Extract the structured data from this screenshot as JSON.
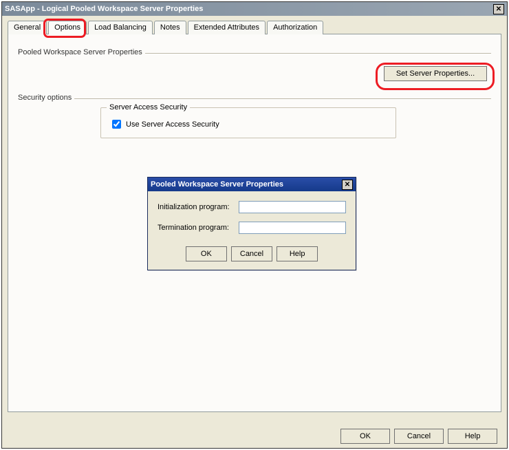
{
  "window": {
    "title": "SASApp - Logical Pooled Workspace Server Properties"
  },
  "tabs": {
    "items": [
      {
        "label": "General"
      },
      {
        "label": "Options"
      },
      {
        "label": "Load Balancing"
      },
      {
        "label": "Notes"
      },
      {
        "label": "Extended Attributes"
      },
      {
        "label": "Authorization"
      }
    ],
    "active_index": 1
  },
  "groups": {
    "pooled_label": "Pooled Workspace Server Properties",
    "security_label": "Security options"
  },
  "buttons": {
    "set_server_properties": "Set Server Properties...",
    "ok": "OK",
    "cancel": "Cancel",
    "help": "Help"
  },
  "fieldset": {
    "legend": "Server Access Security",
    "use_server_access_label": "Use Server Access Security",
    "use_server_access_checked": true
  },
  "inner_dialog": {
    "title": "Pooled Workspace Server Properties",
    "init_label": "Initialization program:",
    "init_value": "",
    "term_label": "Termination program:",
    "term_value": "",
    "ok": "OK",
    "cancel": "Cancel",
    "help": "Help"
  }
}
